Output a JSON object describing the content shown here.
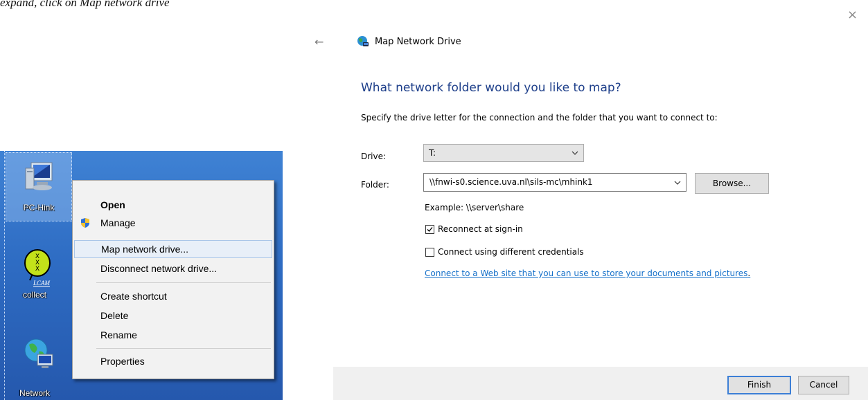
{
  "top_text": "expand, click on Map network drive",
  "desktop": {
    "icons": [
      {
        "label": "PC-Hink"
      },
      {
        "label": "collect",
        "sublabel": "LCAM"
      },
      {
        "label": "Network"
      }
    ],
    "context_menu": {
      "items": [
        {
          "label": "Open",
          "bold": true
        },
        {
          "label": "Manage",
          "icon": "uac-shield-icon"
        },
        {
          "label": "Map network drive...",
          "highlighted": true
        },
        {
          "label": "Disconnect network drive..."
        },
        {
          "label": "Create shortcut"
        },
        {
          "label": "Delete"
        },
        {
          "label": "Rename"
        },
        {
          "label": "Properties"
        }
      ]
    }
  },
  "dialog": {
    "title": "Map Network Drive",
    "heading": "What network folder would you like to map?",
    "instruction": "Specify the drive letter for the connection and the folder that you want to connect to:",
    "drive_label": "Drive:",
    "drive_value": "T:",
    "folder_label": "Folder:",
    "folder_value": "\\\\fnwi-s0.science.uva.nl\\sils-mc\\mhink1",
    "browse_label": "Browse...",
    "example": "Example: \\\\server\\share",
    "reconnect_label": "Reconnect at sign-in",
    "reconnect_checked": true,
    "credentials_label": "Connect using different credentials",
    "credentials_checked": false,
    "link_text": "Connect to a Web site that you can use to store your documents and pictures",
    "link_suffix": ".",
    "finish_label": "Finish",
    "cancel_label": "Cancel",
    "close_glyph": "×",
    "back_glyph": "←",
    "accent_color": "#1e3f8a",
    "link_color": "#1570c9"
  }
}
